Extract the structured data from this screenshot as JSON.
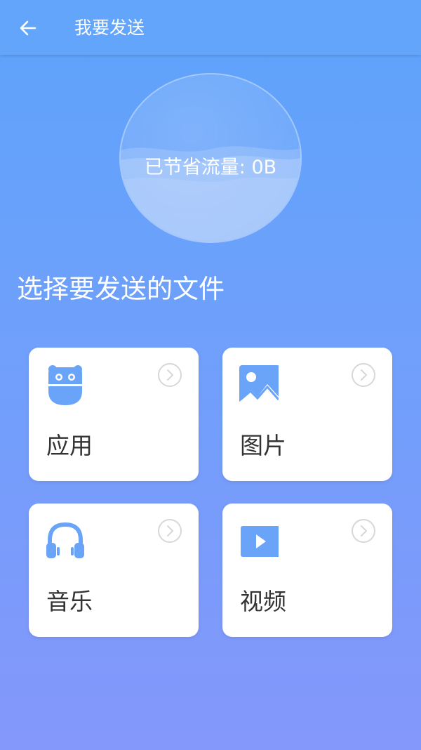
{
  "header": {
    "back_icon": "arrow-left-icon",
    "title": "我要发送"
  },
  "savings": {
    "text": "已节省流量: 0B"
  },
  "section": {
    "title": "选择要发送的文件"
  },
  "colors": {
    "accent": "#62a5fb",
    "icon_blue": "#6aa4f8",
    "chevron_gray": "#d7d7d7"
  },
  "categories": [
    {
      "label": "应用",
      "icon": "android-bot-icon"
    },
    {
      "label": "图片",
      "icon": "image-icon"
    },
    {
      "label": "音乐",
      "icon": "headphones-icon"
    },
    {
      "label": "视频",
      "icon": "play-video-icon"
    }
  ]
}
